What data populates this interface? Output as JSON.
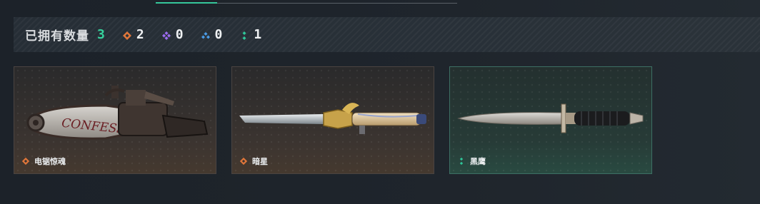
{
  "header": {
    "owned_label": "已拥有数量",
    "owned_total": "3"
  },
  "rarity_counts": [
    {
      "icon": "orange-diamond-icon",
      "color": "#e0763a",
      "count": "2"
    },
    {
      "icon": "purple-diamond-icon",
      "color": "#9b6cf0",
      "count": "0"
    },
    {
      "icon": "blue-diamond-icon",
      "color": "#4a9be6",
      "count": "0"
    },
    {
      "icon": "green-dots-icon",
      "color": "#2fc79a",
      "count": "1"
    }
  ],
  "items": [
    {
      "name": "电锯惊魂",
      "rarity_icon": "orange-diamond-icon",
      "rarity_color": "#e0763a",
      "art_text": "CONFESS"
    },
    {
      "name": "暗星",
      "rarity_icon": "orange-diamond-icon",
      "rarity_color": "#e0763a"
    },
    {
      "name": "黑鹰",
      "rarity_icon": "green-dots-icon",
      "rarity_color": "#2fc79a"
    }
  ],
  "colors": {
    "accent_green": "#36d29d",
    "teal_border": "#3d6f64"
  }
}
